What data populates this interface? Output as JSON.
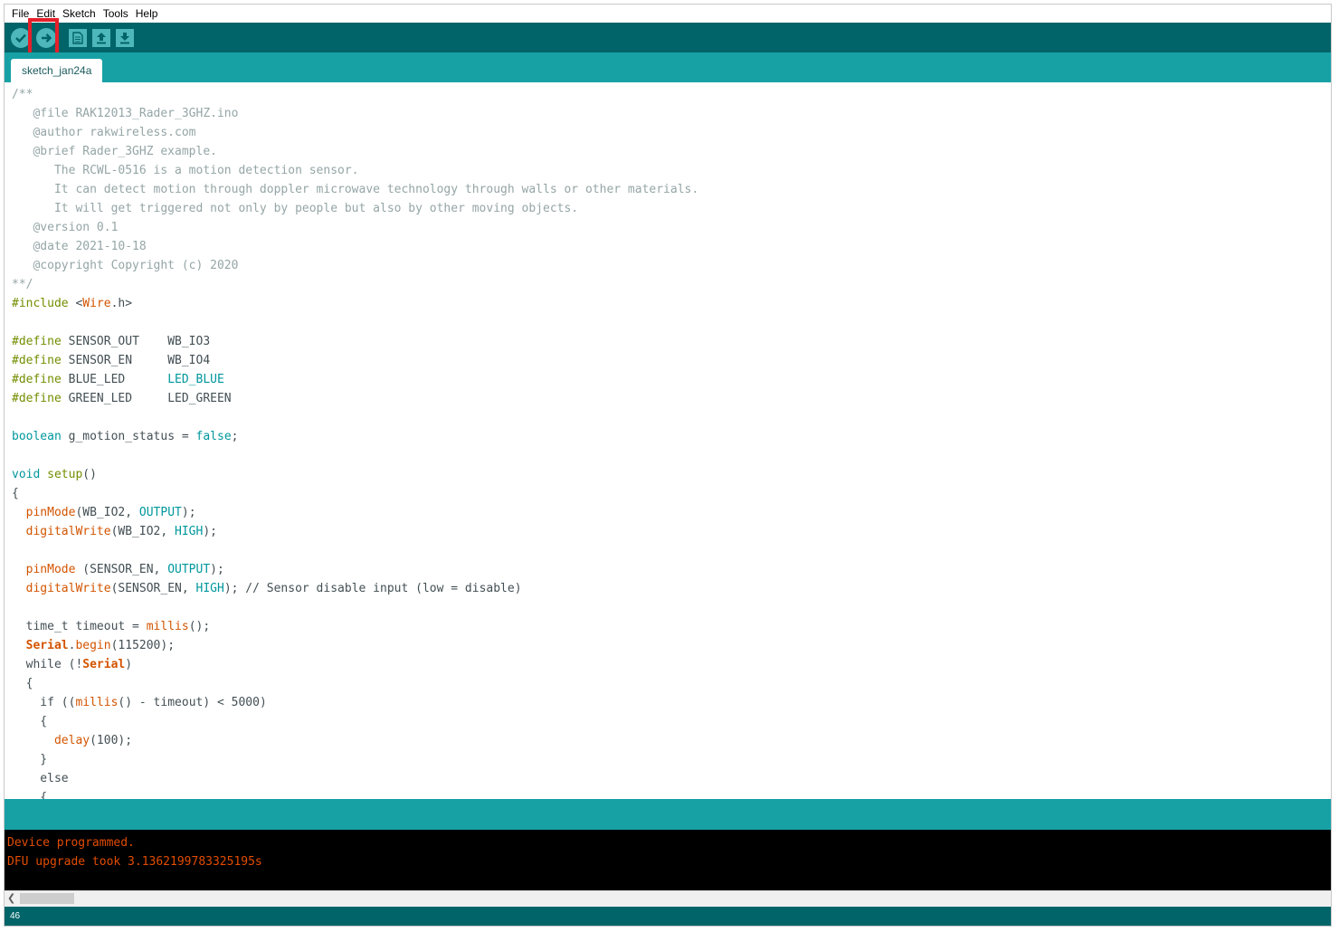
{
  "menu": [
    "File",
    "Edit",
    "Sketch",
    "Tools",
    "Help"
  ],
  "toolbar": {
    "verify_icon": "checkmark-icon",
    "upload_icon": "arrow-right-icon",
    "new_icon": "new-file-icon",
    "open_icon": "arrow-up-icon",
    "save_icon": "arrow-down-icon",
    "highlighted": "upload-button"
  },
  "tab": {
    "label": "sketch_jan24a"
  },
  "code_lines": [
    [
      [
        "/**",
        "c-comment"
      ]
    ],
    [
      [
        "   @file RAK12013_Rader_3GHZ.ino",
        "c-comment"
      ]
    ],
    [
      [
        "   @author rakwireless.com",
        "c-comment"
      ]
    ],
    [
      [
        "   @brief Rader_3GHZ example.",
        "c-comment"
      ]
    ],
    [
      [
        "      The RCWL-0516 is a motion detection sensor.",
        "c-comment"
      ]
    ],
    [
      [
        "      It can detect motion through doppler microwave technology through walls or other materials.",
        "c-comment"
      ]
    ],
    [
      [
        "      It will get triggered not only by people but also by other moving objects.",
        "c-comment"
      ]
    ],
    [
      [
        "   @version 0.1",
        "c-comment"
      ]
    ],
    [
      [
        "   @date 2021-10-18",
        "c-comment"
      ]
    ],
    [
      [
        "   @copyright Copyright (c) 2020",
        "c-comment"
      ]
    ],
    [
      [
        "**/",
        "c-comment"
      ]
    ],
    [
      [
        "#include",
        "c-pp"
      ],
      [
        " <",
        "c-dark"
      ],
      [
        "Wire",
        "c-fn"
      ],
      [
        ".h>",
        "c-dark"
      ]
    ],
    [],
    [
      [
        "#define",
        "c-pp"
      ],
      [
        " SENSOR_OUT    WB_IO3",
        "c-dark"
      ]
    ],
    [
      [
        "#define",
        "c-pp"
      ],
      [
        " SENSOR_EN     WB_IO4",
        "c-dark"
      ]
    ],
    [
      [
        "#define",
        "c-pp"
      ],
      [
        " BLUE_LED      ",
        "c-dark"
      ],
      [
        "LED_BLUE",
        "c-kw"
      ]
    ],
    [
      [
        "#define",
        "c-pp"
      ],
      [
        " GREEN_LED     LED_GREEN",
        "c-dark"
      ]
    ],
    [],
    [
      [
        "boolean",
        "c-kw"
      ],
      [
        " g_motion_status = ",
        "c-dark"
      ],
      [
        "false",
        "c-kw"
      ],
      [
        ";",
        "c-dark"
      ]
    ],
    [],
    [
      [
        "void",
        "c-kw"
      ],
      [
        " ",
        "c-dark"
      ],
      [
        "setup",
        "c-pp"
      ],
      [
        "()",
        "c-dark"
      ]
    ],
    [
      [
        "{",
        "c-dark"
      ]
    ],
    [
      [
        "  ",
        "c-dark"
      ],
      [
        "pinMode",
        "c-fn"
      ],
      [
        "(WB_IO2, ",
        "c-dark"
      ],
      [
        "OUTPUT",
        "c-kw"
      ],
      [
        ");",
        "c-dark"
      ]
    ],
    [
      [
        "  ",
        "c-dark"
      ],
      [
        "digitalWrite",
        "c-fn"
      ],
      [
        "(WB_IO2, ",
        "c-dark"
      ],
      [
        "HIGH",
        "c-kw"
      ],
      [
        ");",
        "c-dark"
      ]
    ],
    [],
    [
      [
        "  ",
        "c-dark"
      ],
      [
        "pinMode",
        "c-fn"
      ],
      [
        " (SENSOR_EN, ",
        "c-dark"
      ],
      [
        "OUTPUT",
        "c-kw"
      ],
      [
        ");",
        "c-dark"
      ]
    ],
    [
      [
        "  ",
        "c-dark"
      ],
      [
        "digitalWrite",
        "c-fn"
      ],
      [
        "(SENSOR_EN, ",
        "c-dark"
      ],
      [
        "HIGH",
        "c-kw"
      ],
      [
        "); // Sensor disable input (low = disable)",
        "c-dark"
      ]
    ],
    [],
    [
      [
        "  time_t timeout = ",
        "c-dark"
      ],
      [
        "millis",
        "c-fn"
      ],
      [
        "();",
        "c-dark"
      ]
    ],
    [
      [
        "  ",
        "c-dark"
      ],
      [
        "Serial",
        "c-serial"
      ],
      [
        ".",
        "c-dark"
      ],
      [
        "begin",
        "c-fn"
      ],
      [
        "(115200);",
        "c-dark"
      ]
    ],
    [
      [
        "  while (!",
        "c-dark"
      ],
      [
        "Serial",
        "c-serial"
      ],
      [
        ")",
        "c-dark"
      ]
    ],
    [
      [
        "  {",
        "c-dark"
      ]
    ],
    [
      [
        "    if ((",
        "c-dark"
      ],
      [
        "millis",
        "c-fn"
      ],
      [
        "() - timeout) < 5000)",
        "c-dark"
      ]
    ],
    [
      [
        "    {",
        "c-dark"
      ]
    ],
    [
      [
        "      ",
        "c-dark"
      ],
      [
        "delay",
        "c-fn"
      ],
      [
        "(100);",
        "c-dark"
      ]
    ],
    [
      [
        "    }",
        "c-dark"
      ]
    ],
    [
      [
        "    else",
        "c-dark"
      ]
    ],
    [
      [
        "    {",
        "c-dark"
      ]
    ]
  ],
  "console": {
    "lines": [
      "Device programmed.",
      "DFU upgrade took 3.1362199783325195s"
    ]
  },
  "status": {
    "line_number": "46"
  }
}
